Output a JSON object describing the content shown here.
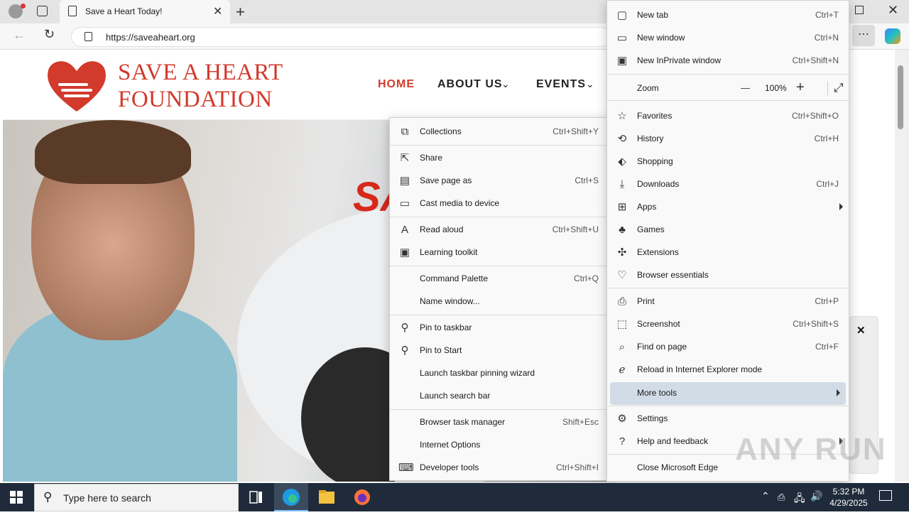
{
  "browser": {
    "tab_title": "Save a Heart Today!",
    "url": "https://saveaheart.org"
  },
  "site": {
    "brand_line1": "SAVE A HEART",
    "brand_line2": "FOUNDATION",
    "nav": [
      "HOME",
      "ABOUT US",
      "EVENTS"
    ],
    "hero_fragment": "SA"
  },
  "main_menu": {
    "items": [
      {
        "label": "New tab",
        "shortcut": "Ctrl+T",
        "icon": "new-tab-icon"
      },
      {
        "label": "New window",
        "shortcut": "Ctrl+N",
        "icon": "window-icon"
      },
      {
        "label": "New InPrivate window",
        "shortcut": "Ctrl+Shift+N",
        "icon": "inprivate-icon"
      },
      {
        "label": "Zoom",
        "zoom_value": "100%",
        "icon": "zoom-icon"
      },
      {
        "label": "Favorites",
        "shortcut": "Ctrl+Shift+O",
        "icon": "star-icon"
      },
      {
        "label": "History",
        "shortcut": "Ctrl+H",
        "icon": "history-icon"
      },
      {
        "label": "Shopping",
        "shortcut": "",
        "icon": "tag-icon"
      },
      {
        "label": "Downloads",
        "shortcut": "Ctrl+J",
        "icon": "download-icon"
      },
      {
        "label": "Apps",
        "shortcut": "",
        "icon": "apps-icon"
      },
      {
        "label": "Games",
        "shortcut": "",
        "icon": "games-icon"
      },
      {
        "label": "Extensions",
        "shortcut": "",
        "icon": "puzzle-icon"
      },
      {
        "label": "Browser essentials",
        "shortcut": "",
        "icon": "heart-pulse-icon"
      },
      {
        "label": "Print",
        "shortcut": "Ctrl+P",
        "icon": "print-icon"
      },
      {
        "label": "Screenshot",
        "shortcut": "Ctrl+Shift+S",
        "icon": "screenshot-icon"
      },
      {
        "label": "Find on page",
        "shortcut": "Ctrl+F",
        "icon": "find-icon"
      },
      {
        "label": "Reload in Internet Explorer mode",
        "shortcut": "",
        "icon": "ie-icon"
      },
      {
        "label": "More tools",
        "shortcut": "",
        "icon": ""
      },
      {
        "label": "Settings",
        "shortcut": "",
        "icon": "gear-icon"
      },
      {
        "label": "Help and feedback",
        "shortcut": "",
        "icon": "help-icon"
      },
      {
        "label": "Close Microsoft Edge",
        "shortcut": "",
        "icon": ""
      }
    ]
  },
  "more_tools_menu": {
    "items": [
      {
        "label": "Collections",
        "shortcut": "Ctrl+Shift+Y",
        "icon": "collections-icon"
      },
      {
        "label": "Share",
        "shortcut": "",
        "icon": "share-icon"
      },
      {
        "label": "Save page as",
        "shortcut": "Ctrl+S",
        "icon": "save-page-icon"
      },
      {
        "label": "Cast media to device",
        "shortcut": "",
        "icon": "cast-icon"
      },
      {
        "label": "Read aloud",
        "shortcut": "Ctrl+Shift+U",
        "icon": "read-aloud-icon"
      },
      {
        "label": "Learning toolkit",
        "shortcut": "",
        "icon": "learning-icon"
      },
      {
        "label": "Command Palette",
        "shortcut": "Ctrl+Q",
        "icon": ""
      },
      {
        "label": "Name window...",
        "shortcut": "",
        "icon": ""
      },
      {
        "label": "Pin to taskbar",
        "shortcut": "",
        "icon": "pin-icon"
      },
      {
        "label": "Pin to Start",
        "shortcut": "",
        "icon": "pin-icon"
      },
      {
        "label": "Launch taskbar pinning wizard",
        "shortcut": "",
        "icon": ""
      },
      {
        "label": "Launch search bar",
        "shortcut": "",
        "icon": ""
      },
      {
        "label": "Browser task manager",
        "shortcut": "Shift+Esc",
        "icon": ""
      },
      {
        "label": "Internet Options",
        "shortcut": "",
        "icon": ""
      },
      {
        "label": "Developer tools",
        "shortcut": "Ctrl+Shift+I",
        "icon": "devtools-icon"
      }
    ]
  },
  "taskbar": {
    "search_placeholder": "Type here to search",
    "time": "5:32 PM",
    "date": "4/29/2025"
  },
  "watermark": "ANY RUN"
}
